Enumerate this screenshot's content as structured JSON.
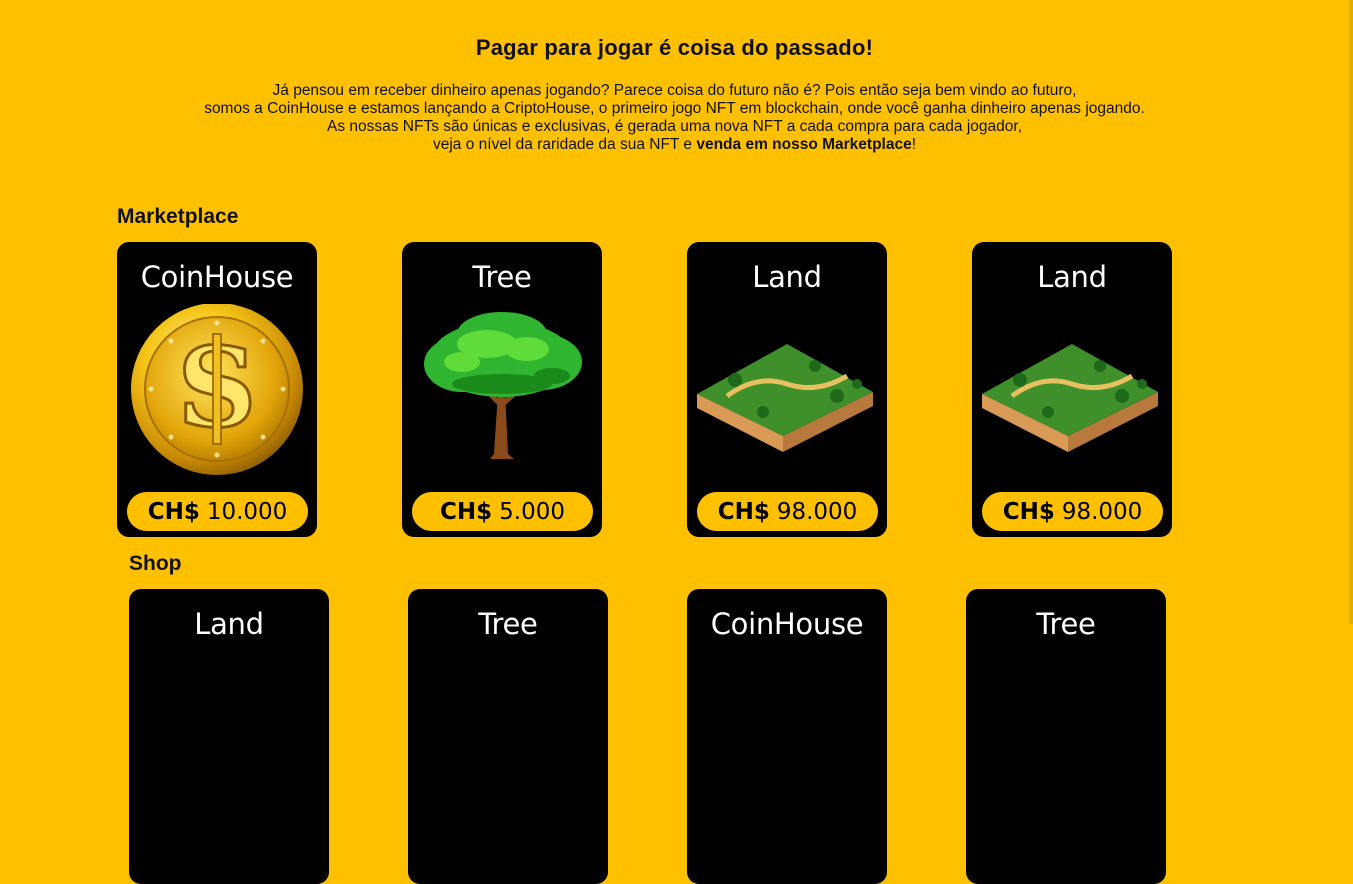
{
  "hero": {
    "title": "Pagar para jogar é coisa do passado!",
    "lines": [
      "Já pensou em receber dinheiro apenas jogando? Parece coisa do futuro não é? Pois então seja bem vindo ao futuro,",
      "somos a CoinHouse e estamos lançando a CriptoHouse, o primeiro jogo NFT em blockchain, onde você ganha dinheiro apenas jogando.",
      "As nossas NFTs são únicas e exclusivas, é gerada uma nova NFT a cada compra para cada jogador,"
    ],
    "last_line_start": "veja o nível da raridade da sua NFT e ",
    "last_line_bold": "venda em nosso Marketplace",
    "last_line_end": "!"
  },
  "marketplace": {
    "title": "Marketplace",
    "items": [
      {
        "name": "CoinHouse",
        "currency": "CH$",
        "price": "10.000",
        "art": "gold-coin-icon"
      },
      {
        "name": "Tree",
        "currency": "CH$",
        "price": "5.000",
        "art": "tree-icon"
      },
      {
        "name": "Land",
        "currency": "CH$",
        "price": "98.000",
        "art": "land-tile-icon"
      },
      {
        "name": "Land",
        "currency": "CH$",
        "price": "98.000",
        "art": "land-tile-icon"
      }
    ]
  },
  "shop": {
    "title": "Shop",
    "items": [
      {
        "name": "Land"
      },
      {
        "name": "Tree"
      },
      {
        "name": "CoinHouse"
      },
      {
        "name": "Tree"
      }
    ]
  },
  "colors": {
    "background": "#ffc000",
    "card": "#000000",
    "text": "#111111"
  }
}
